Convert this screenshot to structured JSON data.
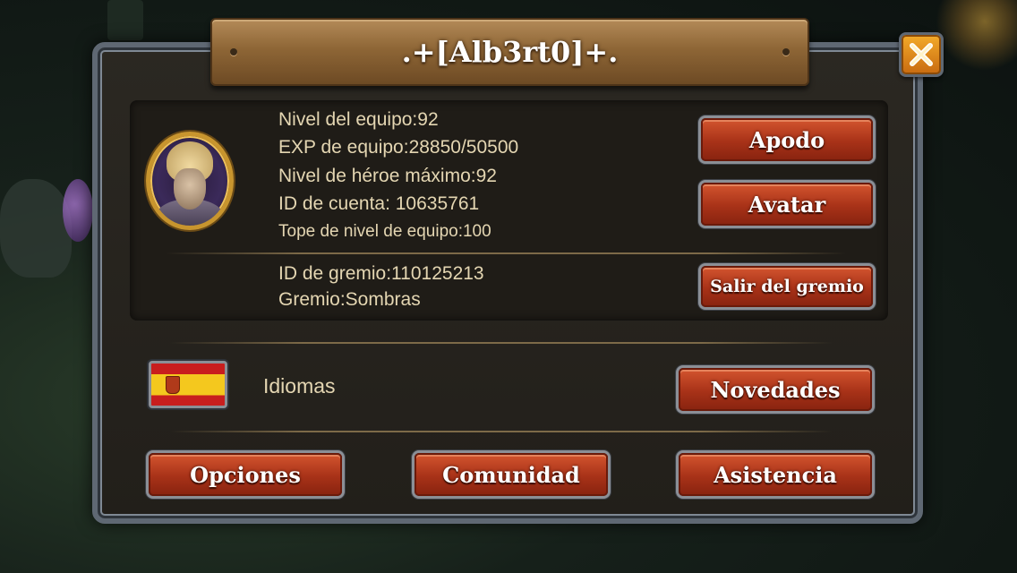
{
  "window": {
    "title": ".+[Alb3rt0]+."
  },
  "icons": {
    "close": "close-x-icon",
    "flag": "spain-flag-icon",
    "avatar": "hero-avatar"
  },
  "stats": {
    "team_level": "Nivel del equipo:92",
    "team_exp": "EXP de equipo:28850/50500",
    "max_hero_level": "Nivel de héroe máximo:92",
    "account_id": "ID de cuenta: 10635761",
    "team_level_cap": "Tope de nivel de equipo:100",
    "guild_id": "ID de gremio:110125213",
    "guild": "Gremio:Sombras"
  },
  "buttons": {
    "nickname": "Apodo",
    "avatar": "Avatar",
    "leave_guild": "Salir del gremio",
    "news": "Novedades",
    "options": "Opciones",
    "community": "Comunidad",
    "support": "Asistencia"
  },
  "language": {
    "label": "Idiomas"
  },
  "colors": {
    "button": "#a83218",
    "gold_frame": "#c8952e",
    "text": "#e4d6b2",
    "close": "#f3ab2a"
  }
}
